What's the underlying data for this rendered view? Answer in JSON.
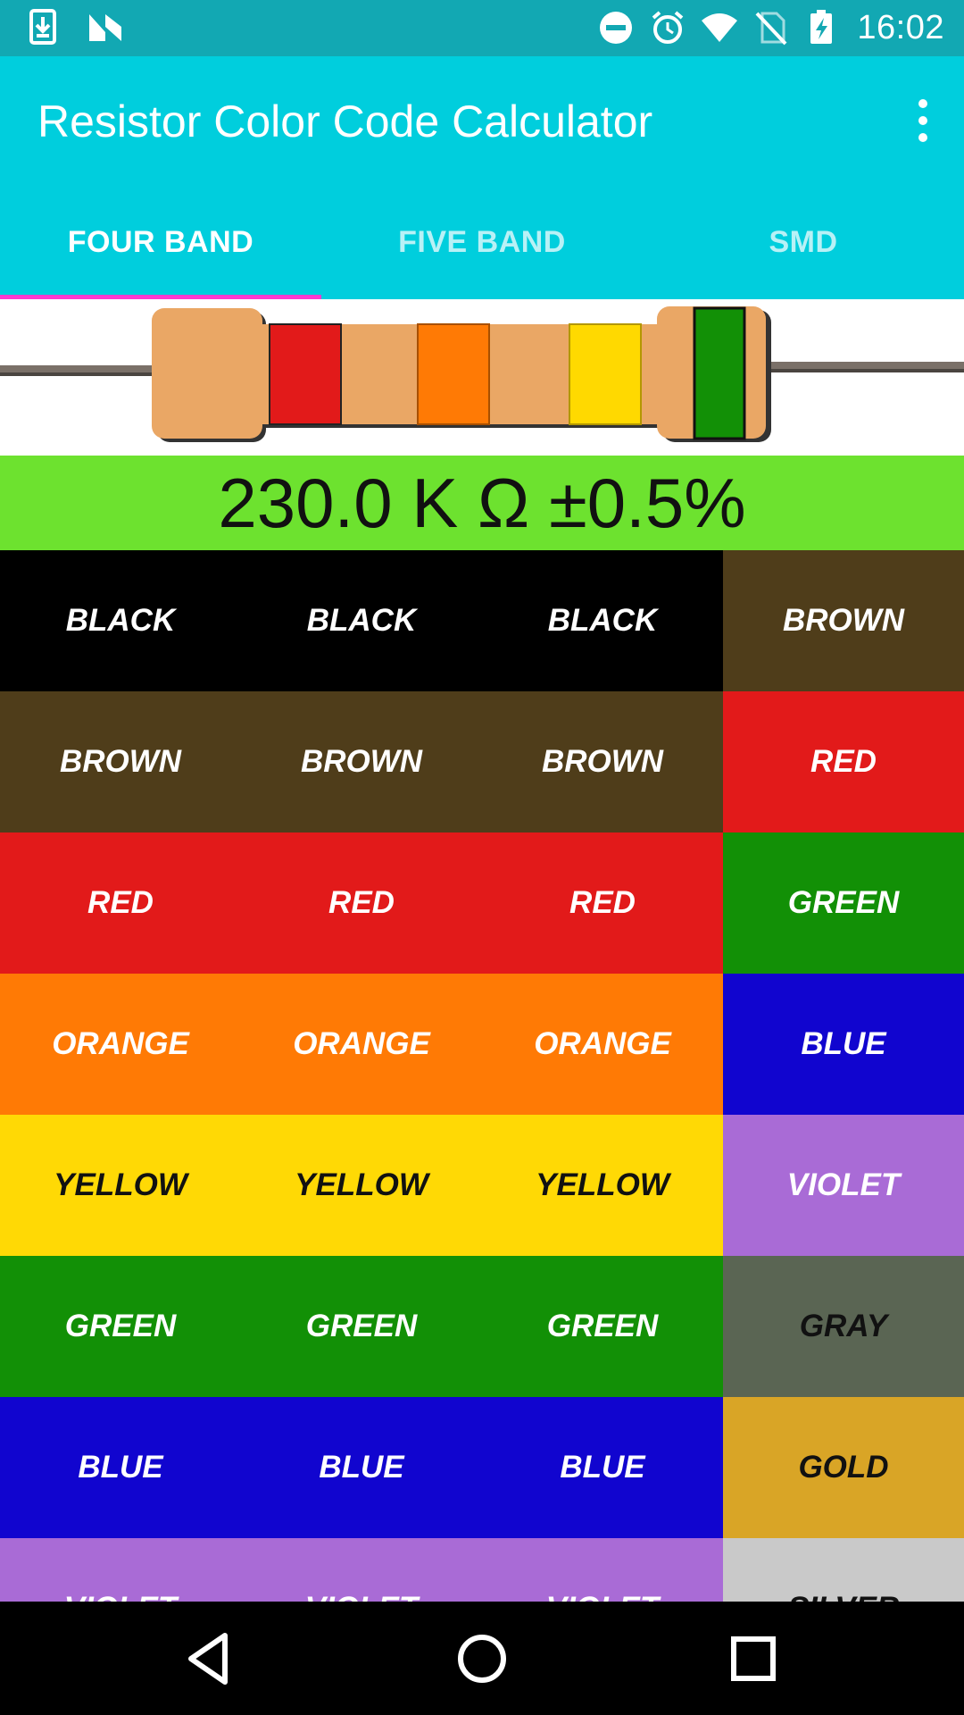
{
  "status_bar": {
    "time": "16:02",
    "left_icons": [
      "download-icon",
      "n-logo-icon"
    ],
    "right_icons": [
      "do-not-disturb-icon",
      "alarm-icon",
      "wifi-icon",
      "no-sim-icon",
      "battery-charging-icon"
    ]
  },
  "app_bar": {
    "title": "Resistor Color Code Calculator",
    "menu_icon": "overflow-menu-icon"
  },
  "tabs": [
    {
      "label": "FOUR BAND",
      "active": true
    },
    {
      "label": "FIVE BAND",
      "active": false
    },
    {
      "label": "SMD",
      "active": false
    }
  ],
  "resistor": {
    "bands": [
      "red",
      "orange",
      "yellow",
      "green"
    ],
    "band_colors": [
      "#e21a1a",
      "#ff7a05",
      "#ffd900",
      "#129006"
    ],
    "body_color": "#eaa765"
  },
  "result": {
    "value": "230.0 K Ω ±0.5%"
  },
  "grid": {
    "rows": [
      {
        "cells": [
          {
            "label": "BLACK",
            "bg": "#000000",
            "fg": "#ffffff"
          },
          {
            "label": "BLACK",
            "bg": "#000000",
            "fg": "#ffffff"
          },
          {
            "label": "BLACK",
            "bg": "#000000",
            "fg": "#ffffff"
          },
          {
            "label": "BROWN",
            "bg": "#4f3d1a",
            "fg": "#ffffff"
          }
        ]
      },
      {
        "cells": [
          {
            "label": "BROWN",
            "bg": "#4f3d1a",
            "fg": "#ffffff"
          },
          {
            "label": "BROWN",
            "bg": "#4f3d1a",
            "fg": "#ffffff"
          },
          {
            "label": "BROWN",
            "bg": "#4f3d1a",
            "fg": "#ffffff"
          },
          {
            "label": "RED",
            "bg": "#e21a1a",
            "fg": "#ffffff"
          }
        ]
      },
      {
        "cells": [
          {
            "label": "RED",
            "bg": "#e21a1a",
            "fg": "#ffffff"
          },
          {
            "label": "RED",
            "bg": "#e21a1a",
            "fg": "#ffffff"
          },
          {
            "label": "RED",
            "bg": "#e21a1a",
            "fg": "#ffffff"
          },
          {
            "label": "GREEN",
            "bg": "#129006",
            "fg": "#ffffff"
          }
        ]
      },
      {
        "cells": [
          {
            "label": "ORANGE",
            "bg": "#ff7a05",
            "fg": "#ffffff"
          },
          {
            "label": "ORANGE",
            "bg": "#ff7a05",
            "fg": "#ffffff"
          },
          {
            "label": "ORANGE",
            "bg": "#ff7a05",
            "fg": "#ffffff"
          },
          {
            "label": "BLUE",
            "bg": "#1105cf",
            "fg": "#ffffff"
          }
        ]
      },
      {
        "cells": [
          {
            "label": "YELLOW",
            "bg": "#ffd905",
            "fg": "#111111"
          },
          {
            "label": "YELLOW",
            "bg": "#ffd905",
            "fg": "#111111"
          },
          {
            "label": "YELLOW",
            "bg": "#ffd905",
            "fg": "#111111"
          },
          {
            "label": "VIOLET",
            "bg": "#a96bd6",
            "fg": "#ffffff"
          }
        ]
      },
      {
        "cells": [
          {
            "label": "GREEN",
            "bg": "#129006",
            "fg": "#ffffff"
          },
          {
            "label": "GREEN",
            "bg": "#129006",
            "fg": "#ffffff"
          },
          {
            "label": "GREEN",
            "bg": "#129006",
            "fg": "#ffffff"
          },
          {
            "label": "GRAY",
            "bg": "#5a6553",
            "fg": "#111111"
          }
        ]
      },
      {
        "cells": [
          {
            "label": "BLUE",
            "bg": "#1105cf",
            "fg": "#ffffff"
          },
          {
            "label": "BLUE",
            "bg": "#1105cf",
            "fg": "#ffffff"
          },
          {
            "label": "BLUE",
            "bg": "#1105cf",
            "fg": "#ffffff"
          },
          {
            "label": "GOLD",
            "bg": "#d9a526",
            "fg": "#111111"
          }
        ]
      },
      {
        "cells": [
          {
            "label": "VIOLET",
            "bg": "#a96bd6",
            "fg": "#ffffff"
          },
          {
            "label": "VIOLET",
            "bg": "#a96bd6",
            "fg": "#ffffff"
          },
          {
            "label": "VIOLET",
            "bg": "#a96bd6",
            "fg": "#ffffff"
          },
          {
            "label": "SILVER",
            "bg": "#c9c9c9",
            "fg": "#111111"
          }
        ]
      }
    ]
  },
  "nav_bar": {
    "icons": [
      "back-icon",
      "home-icon",
      "recents-icon"
    ]
  }
}
